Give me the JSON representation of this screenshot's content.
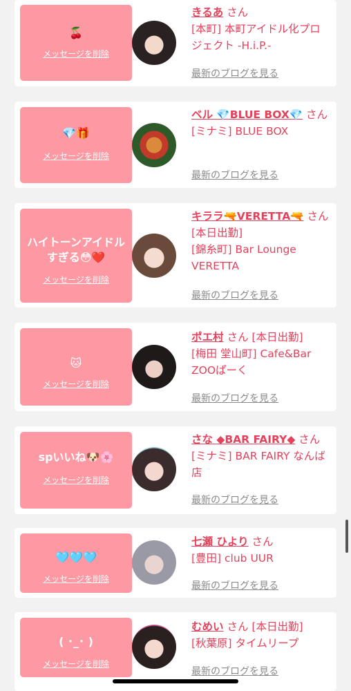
{
  "delete_label": "メッセージを削除",
  "blog_label": "最新のブログを見る",
  "cards": [
    {
      "message": "🍒",
      "name": "きるあ",
      "san": "さん",
      "status": "",
      "shop": "[本町] 本町アイドル化プロジェクト -H.i.P.-"
    },
    {
      "message": "💎🎁",
      "name": "ベル 💎BLUE BOX💎",
      "san": "さん",
      "status": "",
      "shop": "[ミナミ] BLUE BOX"
    },
    {
      "message": "ハイトーンアイドルすぎる😳❤️",
      "name": "キララ🔫VERETTA🔫",
      "san": "さん",
      "status": "[本日出勤]",
      "shop": "[錦糸町] Bar Lounge VERETTA"
    },
    {
      "message": "🐱",
      "name": "ポエ村",
      "san": "さん",
      "status": "[本日出勤]",
      "shop": "[梅田 堂山町] Cafe&Bar ZOOぱーく"
    },
    {
      "message": "spいいね🐶🌸",
      "name": "さな ◆BAR FAIRY◆",
      "san": "さん",
      "status": "",
      "shop": "[ミナミ] BAR FAIRY なんば店"
    },
    {
      "message": "🩵🩵🩵",
      "name": "七瀬 ひより",
      "san": "さん",
      "status": "",
      "shop": "[豊田] club UUR"
    },
    {
      "message": "( ･_･ )",
      "name": "むめい",
      "san": "さん",
      "status": "[本日出勤]",
      "shop": "[秋葉原] タイムリープ"
    }
  ]
}
